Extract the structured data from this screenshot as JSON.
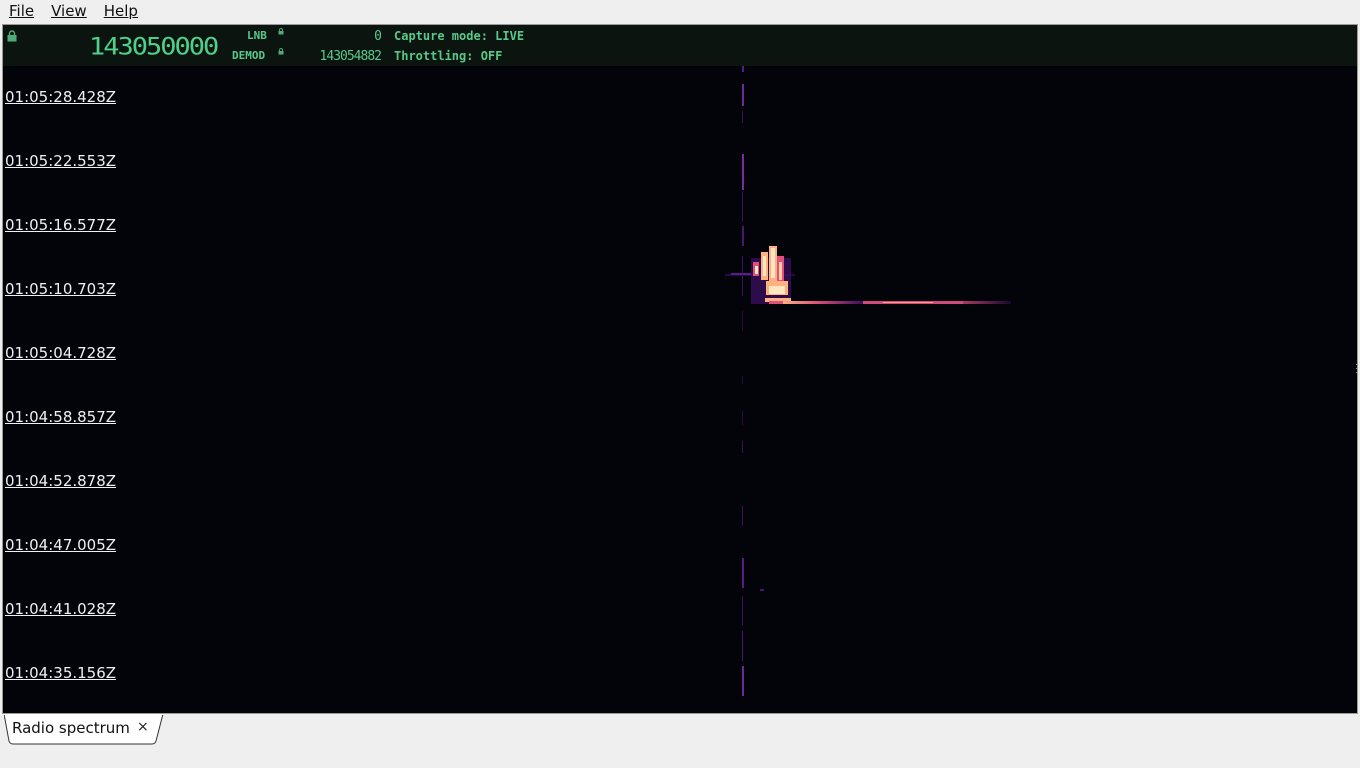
{
  "menu": {
    "file": "File",
    "view": "View",
    "help": "Help"
  },
  "header": {
    "main_frequency": "143050000",
    "lnb_label": "LNB",
    "lnb_value": "0",
    "demod_label": "DEMOD",
    "demod_value": "143054882",
    "capture_mode": "Capture mode: LIVE",
    "throttling": "Throttling: OFF",
    "text_color": "#58c98a"
  },
  "waterfall": {
    "timestamps": [
      "01:05:28.428Z",
      "01:05:22.553Z",
      "01:05:16.577Z",
      "01:05:10.703Z",
      "01:05:04.728Z",
      "01:04:58.857Z",
      "01:04:52.878Z",
      "01:04:47.005Z",
      "01:04:41.028Z",
      "01:04:35.156Z"
    ],
    "background_color": "#03030a",
    "signal_colors": [
      "#3a0f5c",
      "#8a2a8a",
      "#e0507a",
      "#ffb080",
      "#ffe8c0"
    ]
  },
  "tabs": [
    {
      "label": "Radio spectrum",
      "close": "×"
    }
  ]
}
